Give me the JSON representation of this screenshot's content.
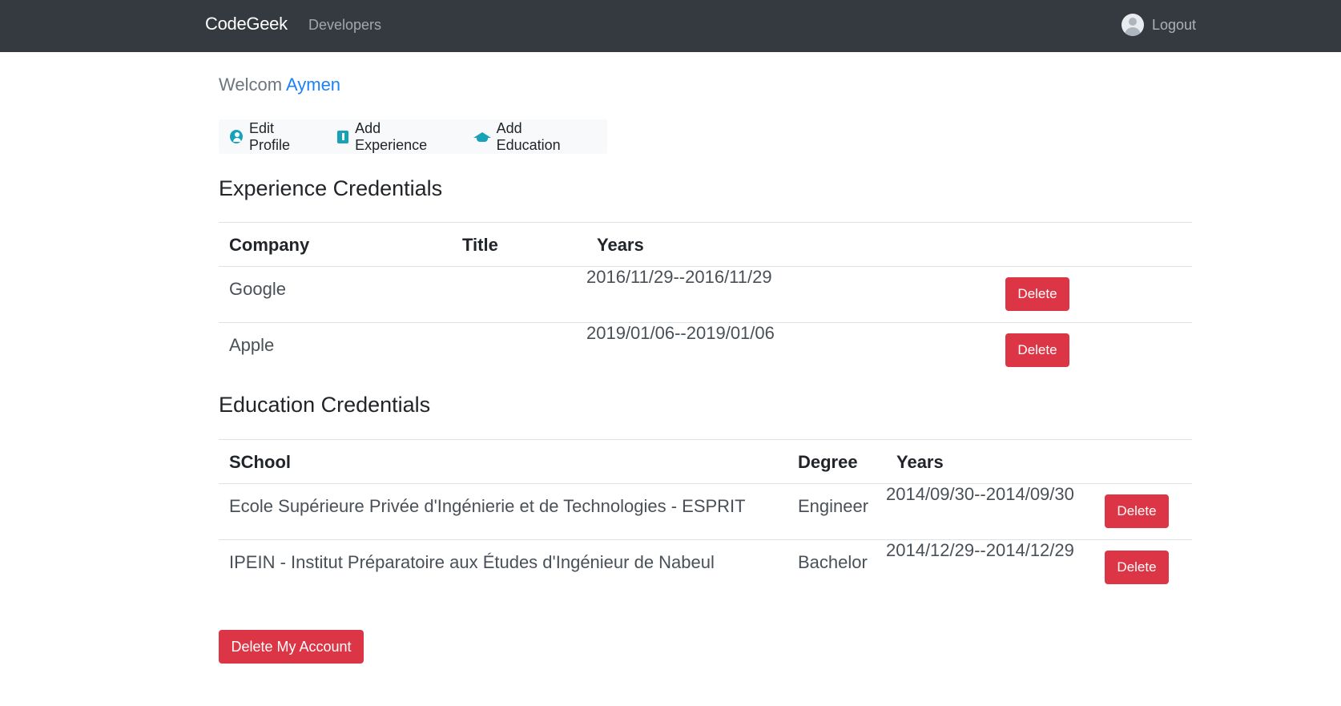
{
  "navbar": {
    "brand": "CodeGeek",
    "developers_link": "Developers",
    "logout_label": "Logout"
  },
  "welcome": {
    "prefix": "Welcom",
    "username": "Aymen"
  },
  "actions": {
    "edit_profile": "Edit Profile",
    "add_experience": "Add Experience",
    "add_education": "Add Education"
  },
  "experience": {
    "heading": "Experience Credentials",
    "columns": [
      "Company",
      "Title",
      "Years"
    ],
    "rows": [
      {
        "company": "Google",
        "title": "",
        "years": "2016/11/29--2016/11/29",
        "action": "Delete"
      },
      {
        "company": "Apple",
        "title": "",
        "years": "2019/01/06--2019/01/06",
        "action": "Delete"
      }
    ]
  },
  "education": {
    "heading": "Education Credentials",
    "columns": [
      "SChool",
      "Degree",
      "Years"
    ],
    "rows": [
      {
        "school": "Ecole Supérieure Privée d'Ingénierie et de Technologies - ESPRIT",
        "degree": "Engineer",
        "years": "2014/09/30--2014/09/30",
        "action": "Delete"
      },
      {
        "school": "IPEIN - Institut Préparatoire aux Études d'Ingénieur de Nabeul",
        "degree": "Bachelor",
        "years": "2014/12/29--2014/12/29",
        "action": "Delete"
      }
    ]
  },
  "delete_account_label": "Delete My Account",
  "colors": {
    "navbar": "#343a40",
    "danger": "#dc3545",
    "info": "#17a2b8",
    "link": "#1a82f7"
  }
}
